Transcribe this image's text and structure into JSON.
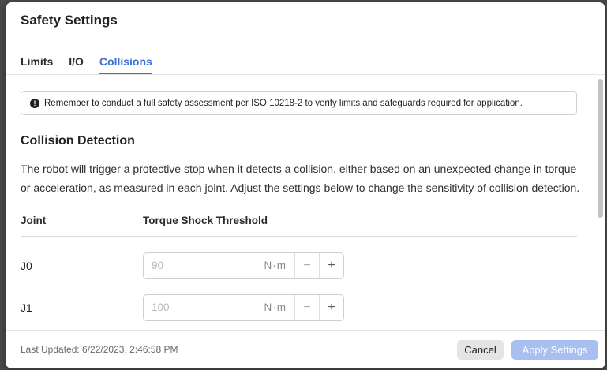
{
  "dialog": {
    "title": "Safety Settings"
  },
  "tabs": [
    {
      "label": "Limits"
    },
    {
      "label": "I/O"
    },
    {
      "label": "Collisions"
    }
  ],
  "active_tab": "Collisions",
  "notice": {
    "icon": "info-icon",
    "text": "Remember to conduct a full safety assessment per ISO 10218-2 to verify limits and safeguards required for application."
  },
  "collision": {
    "title": "Collision Detection",
    "description": "The robot will trigger a protective stop when it detects a collision, either based on an unexpected change in torque or acceleration, as measured in each joint. Adjust the settings below to change the sensitivity of collision detection."
  },
  "table": {
    "headers": [
      "Joint",
      "Torque Shock Threshold"
    ],
    "rows": [
      {
        "joint": "J0",
        "value": "90",
        "unit": "N·m"
      },
      {
        "joint": "J1",
        "value": "100",
        "unit": "N·m"
      }
    ]
  },
  "footer": {
    "last_updated": "Last Updated: 6/22/2023, 2:46:58 PM",
    "cancel_label": "Cancel",
    "apply_label": "Apply Settings"
  },
  "colors": {
    "accent": "#3b6fd6",
    "apply_disabled": "#a8bff2"
  }
}
